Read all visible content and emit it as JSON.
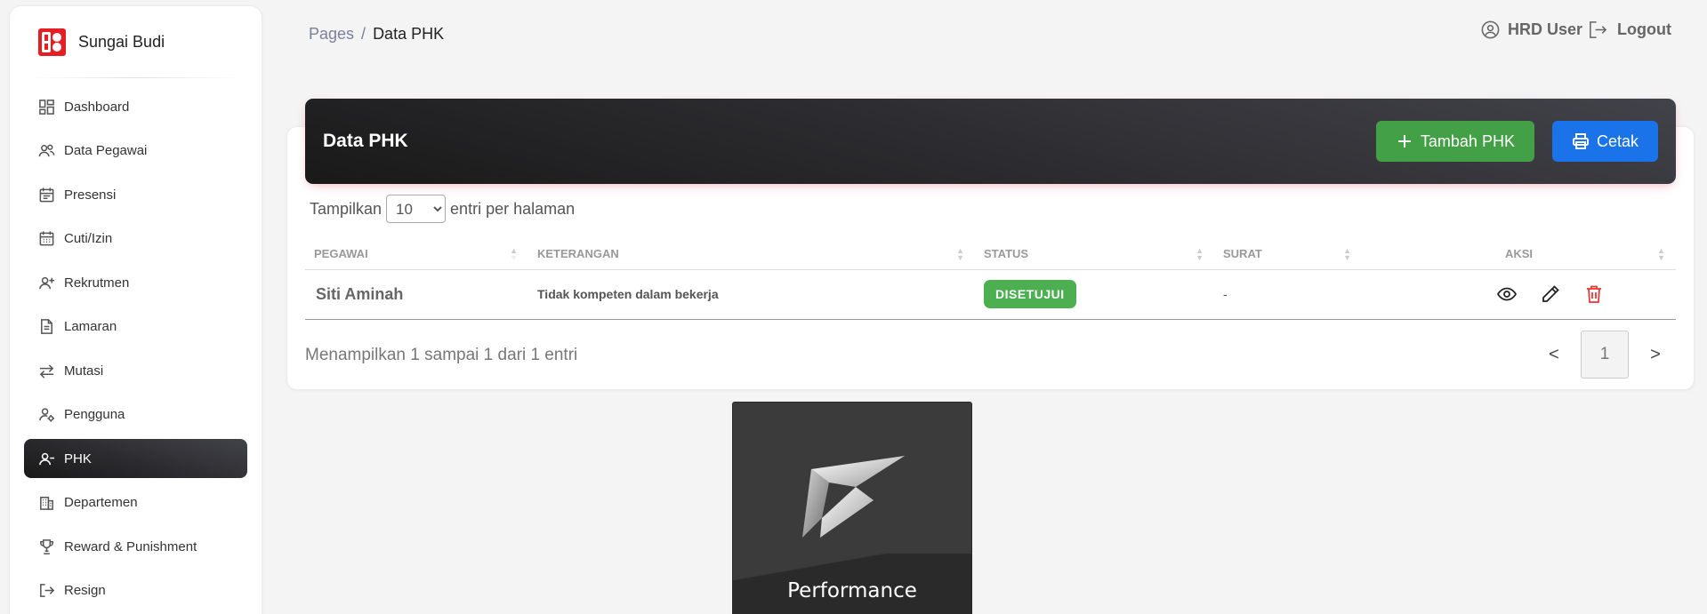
{
  "brand": {
    "name": "Sungai Budi"
  },
  "sidebar": {
    "items": [
      {
        "label": "Dashboard",
        "icon": "dashboard-icon"
      },
      {
        "label": "Data Pegawai",
        "icon": "users-icon"
      },
      {
        "label": "Presensi",
        "icon": "calendar-icon"
      },
      {
        "label": "Cuti/Izin",
        "icon": "calendar-grid-icon"
      },
      {
        "label": "Rekrutmen",
        "icon": "user-plus-icon"
      },
      {
        "label": "Lamaran",
        "icon": "document-icon"
      },
      {
        "label": "Mutasi",
        "icon": "swap-arrows-icon"
      },
      {
        "label": "Pengguna",
        "icon": "user-gear-icon"
      },
      {
        "label": "PHK",
        "icon": "user-minus-icon",
        "active": true
      },
      {
        "label": "Departemen",
        "icon": "building-icon"
      },
      {
        "label": "Reward & Punishment",
        "icon": "trophy-icon"
      },
      {
        "label": "Resign",
        "icon": "logout-icon"
      }
    ]
  },
  "breadcrumb": {
    "parent": "Pages",
    "separator": "/",
    "current": "Data PHK"
  },
  "topbar": {
    "user_label": "HRD User",
    "logout_label": "Logout"
  },
  "card": {
    "title": "Data PHK",
    "add_button": "Tambah PHK",
    "print_button": "Cetak"
  },
  "length_menu": {
    "prefix": "Tampilkan",
    "selected": "10",
    "suffix": "entri per halaman"
  },
  "table": {
    "headers": [
      "PEGAWAI",
      "KETERANGAN",
      "STATUS",
      "SURAT",
      "AKSI"
    ],
    "rows": [
      {
        "pegawai": "Siti Aminah",
        "keterangan": "Tidak kompeten dalam bekerja",
        "status": "DISETUJUI",
        "surat": "-"
      }
    ]
  },
  "footer": {
    "info": "Menampilkan 1 sampai 1 dari 1 entri",
    "prev": "<",
    "page": "1",
    "next": ">"
  },
  "tile": {
    "label": "Performance"
  },
  "colors": {
    "accent_green": "#43a047",
    "accent_blue": "#1a73e8",
    "delete_red": "#e53935",
    "dark_header": "#191919"
  }
}
